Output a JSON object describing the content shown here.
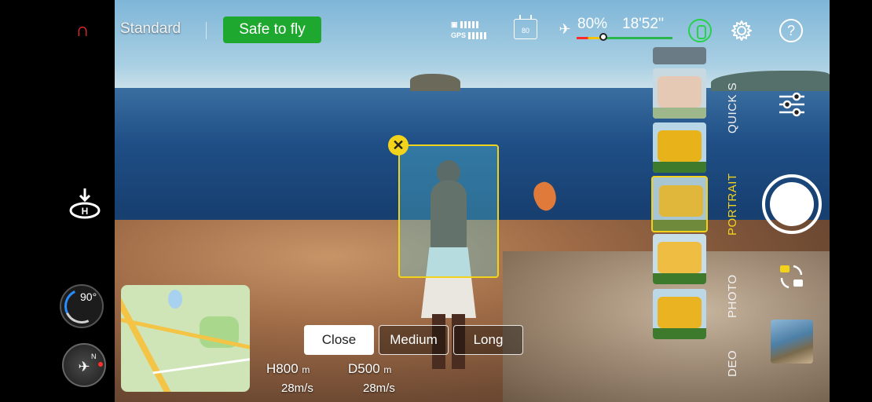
{
  "top_bar": {
    "flight_mode": "Standard",
    "safety_status": "Safe to fly",
    "gps_label": "GPS",
    "rc_signal_value": "80",
    "battery_percent": "80%",
    "flight_time": "18'52''"
  },
  "colors": {
    "accent_yellow": "#f3d21c",
    "safe_green": "#1fa830",
    "gps_green": "#27d14a",
    "brand_red": "#ff2a2a"
  },
  "left_panel": {
    "gimbal_angle": "90°",
    "compass_north": "N"
  },
  "tracking": {
    "distance_options": [
      "Close",
      "Medium",
      "Long"
    ],
    "selected_distance": "Close"
  },
  "telemetry": {
    "height_label": "H",
    "height_value": "800",
    "height_unit": "m",
    "distance_label": "D",
    "distance_value": "500",
    "distance_unit": "m",
    "vertical_speed": "28m/s",
    "horizontal_speed": "28m/s"
  },
  "capture_modes": [
    "QUICK S",
    "PORTRAIT",
    "PHOTO",
    "DEO"
  ],
  "active_capture_mode": "PORTRAIT",
  "icons": {
    "logo": "brand-logo-icon",
    "signal": "remote-signal-icon",
    "rc": "remote-controller-icon",
    "drone_battery": "drone-battery-icon",
    "gps": "gps-status-icon",
    "settings": "gear-icon",
    "help": "help-icon",
    "landing": "auto-landing-icon",
    "sliders": "sliders-icon",
    "switch_camera": "switch-camera-icon"
  }
}
